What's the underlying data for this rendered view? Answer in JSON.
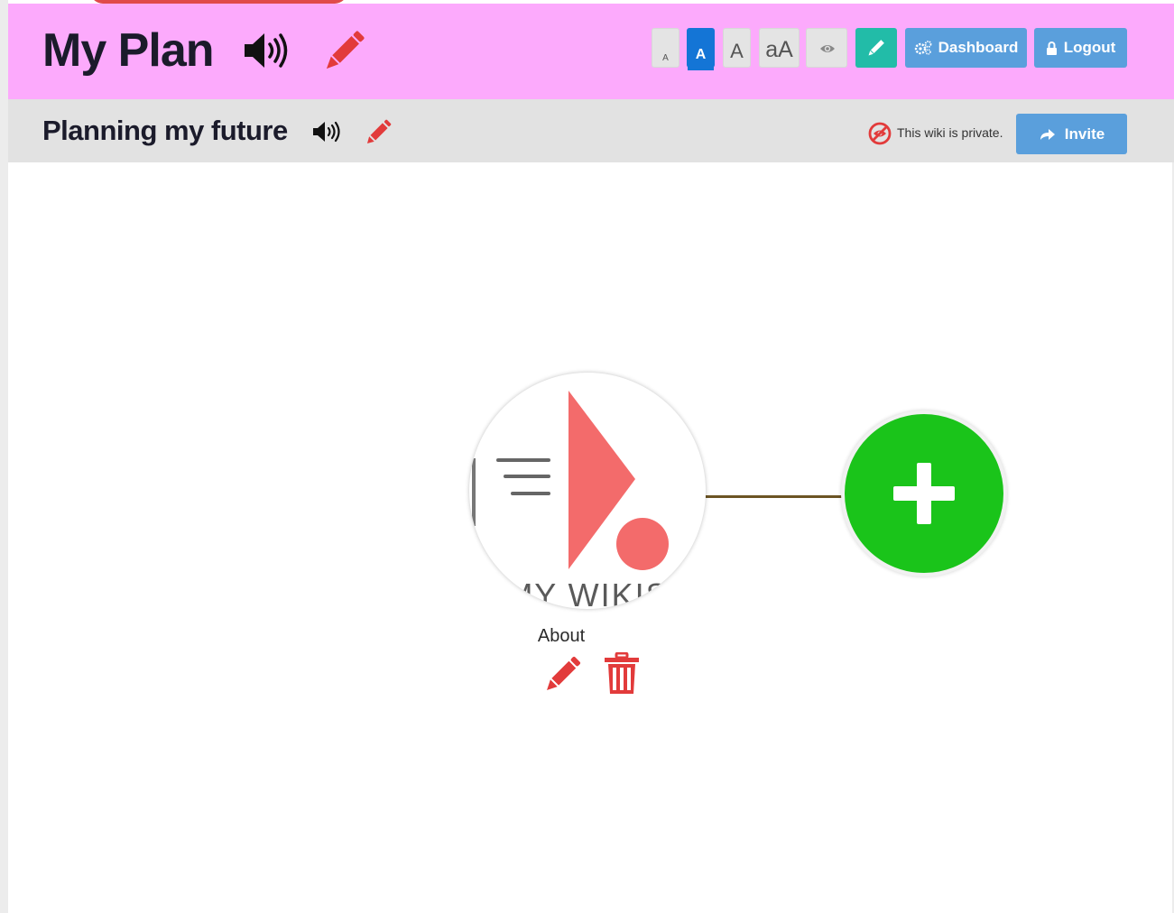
{
  "header": {
    "title": "My Plan",
    "title_audio_icon": "speaker-icon",
    "title_edit_icon": "pencil-icon",
    "text_size_buttons": [
      {
        "label": "A",
        "size": "extra-small",
        "active": false
      },
      {
        "label": "A",
        "size": "small",
        "active": true
      },
      {
        "label": "A",
        "size": "medium",
        "active": false
      },
      {
        "label": "aA",
        "size": "large",
        "active": false
      }
    ],
    "view_icon": "eye-icon",
    "edit_icon": "pencil-icon",
    "dashboard_label": "Dashboard",
    "dashboard_icon": "cogs-icon",
    "logout_label": "Logout",
    "logout_icon": "lock-icon"
  },
  "subheader": {
    "title": "Planning my future",
    "audio_icon": "speaker-icon",
    "edit_icon": "pencil-icon",
    "privacy_icon": "eye-slash-icon",
    "privacy_text": "This wiki is private.",
    "invite_label": "Invite",
    "invite_icon": "share-arrow-icon"
  },
  "canvas": {
    "node": {
      "image_text": "MY WIKIS",
      "label": "About",
      "edit_icon": "pencil-icon",
      "delete_icon": "trash-icon"
    },
    "add_node_icon": "plus-icon"
  },
  "colors": {
    "header_bg": "#fcaafc",
    "subheader_bg": "#e2e2e2",
    "accent_red": "#e23b3b",
    "button_blue": "#5a9fdc",
    "active_blue": "#1475d6",
    "teal": "#22bca8",
    "add_green": "#1ac41a",
    "logo_coral": "#f36b6b"
  }
}
